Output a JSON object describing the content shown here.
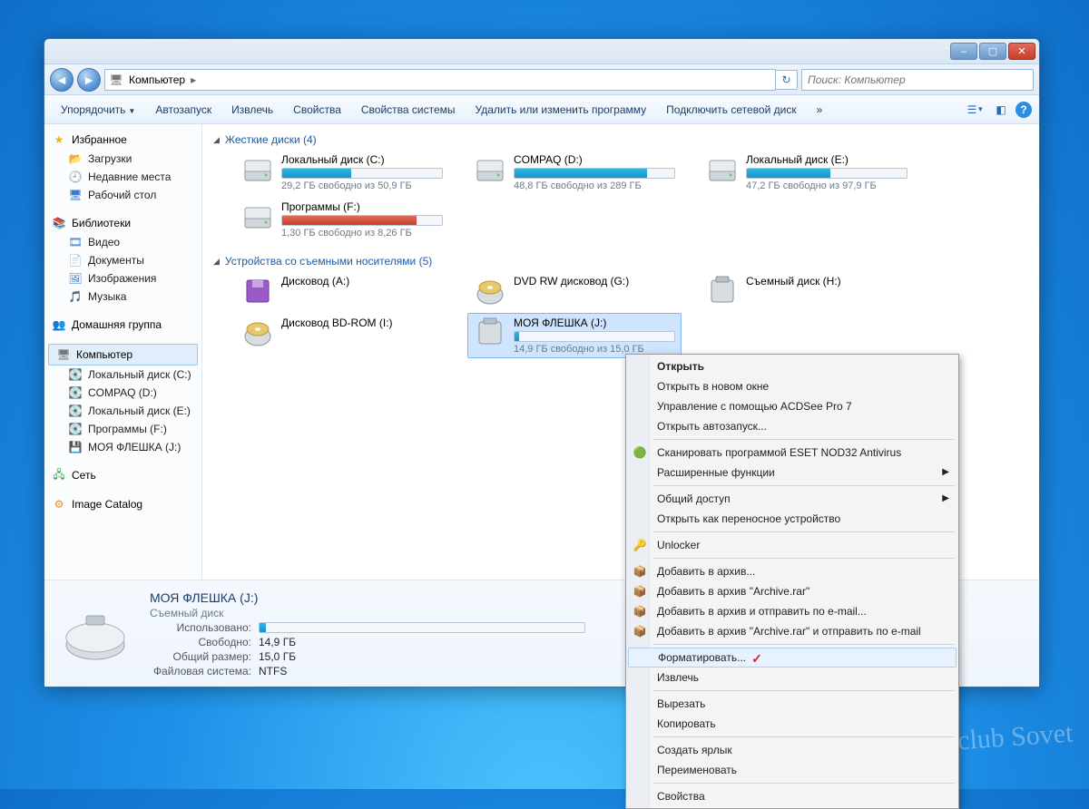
{
  "window_controls": {
    "min": "–",
    "max": "▢",
    "close": "✕"
  },
  "address": {
    "location": "Компьютер",
    "search_placeholder": "Поиск: Компьютер"
  },
  "toolbar": {
    "organize": "Упорядочить",
    "autorun": "Автозапуск",
    "eject": "Извлечь",
    "props": "Свойства",
    "sysprops": "Свойства системы",
    "uninstall": "Удалить или изменить программу",
    "mapdrive": "Подключить сетевой диск",
    "more": "»"
  },
  "sidebar": {
    "favorites": {
      "title": "Избранное",
      "items": [
        "Загрузки",
        "Недавние места",
        "Рабочий стол"
      ]
    },
    "libraries": {
      "title": "Библиотеки",
      "items": [
        "Видео",
        "Документы",
        "Изображения",
        "Музыка"
      ]
    },
    "homegroup": {
      "title": "Домашняя группа"
    },
    "computer": {
      "title": "Компьютер",
      "items": [
        "Локальный диск (C:)",
        "COMPAQ (D:)",
        "Локальный диск (E:)",
        "Программы  (F:)",
        "МОЯ ФЛЕШКА (J:)"
      ]
    },
    "network": {
      "title": "Сеть"
    },
    "catalog": {
      "title": "Image Catalog"
    }
  },
  "sections": {
    "hdd": {
      "title": "Жесткие диски (4)"
    },
    "removable": {
      "title": "Устройства со съемными носителями (5)"
    }
  },
  "drives": {
    "c": {
      "name": "Локальный диск (C:)",
      "sub": "29,2 ГБ свободно из 50,9 ГБ",
      "fill": 43
    },
    "d": {
      "name": "COMPAQ (D:)",
      "sub": "48,8 ГБ свободно из 289 ГБ",
      "fill": 83
    },
    "e": {
      "name": "Локальный диск (E:)",
      "sub": "47,2 ГБ свободно из 97,9 ГБ",
      "fill": 52
    },
    "f": {
      "name": "Программы  (F:)",
      "sub": "1,30 ГБ свободно из 8,26 ГБ",
      "fill": 84,
      "red": true
    },
    "a": {
      "name": "Дисковод (A:)"
    },
    "g": {
      "name": "DVD RW дисковод (G:)"
    },
    "h": {
      "name": "Съемный диск (H:)"
    },
    "i": {
      "name": "Дисковод BD-ROM (I:)"
    },
    "j": {
      "name": "МОЯ ФЛЕШКА (J:)",
      "sub": "14,9 ГБ свободно из 15,0 ГБ",
      "fill": 3
    }
  },
  "details": {
    "title": "МОЯ ФЛЕШКА (J:)",
    "type": "Съемный диск",
    "used_label": "Использовано:",
    "free_label": "Свободно:",
    "free_val": "14,9 ГБ",
    "total_label": "Общий размер:",
    "total_val": "15,0 ГБ",
    "fs_label": "Файловая система:",
    "fs_val": "NTFS",
    "fill": 2
  },
  "context_menu": [
    {
      "t": "Открыть",
      "bold": true
    },
    {
      "t": "Открыть в новом окне"
    },
    {
      "t": "Управление с помощью ACDSee Pro 7"
    },
    {
      "t": "Открыть автозапуск..."
    },
    {
      "sep": true
    },
    {
      "t": "Сканировать программой ESET NOD32 Antivirus",
      "ic": "🟢"
    },
    {
      "t": "Расширенные функции",
      "arrow": true
    },
    {
      "sep": true
    },
    {
      "t": "Общий доступ",
      "arrow": true
    },
    {
      "t": "Открыть как переносное устройство"
    },
    {
      "sep": true
    },
    {
      "t": "Unlocker",
      "ic": "🔑"
    },
    {
      "sep": true
    },
    {
      "t": "Добавить в архив...",
      "ic": "📦"
    },
    {
      "t": "Добавить в архив \"Archive.rar\"",
      "ic": "📦"
    },
    {
      "t": "Добавить в архив и отправить по e-mail...",
      "ic": "📦"
    },
    {
      "t": "Добавить в архив \"Archive.rar\" и отправить по e-mail",
      "ic": "📦"
    },
    {
      "sep": true
    },
    {
      "t": "Форматировать...",
      "hl": true,
      "check": true
    },
    {
      "t": "Извлечь"
    },
    {
      "sep": true
    },
    {
      "t": "Вырезать"
    },
    {
      "t": "Копировать"
    },
    {
      "sep": true
    },
    {
      "t": "Создать ярлык"
    },
    {
      "t": "Переименовать"
    },
    {
      "sep": true
    },
    {
      "t": "Свойства"
    }
  ],
  "watermark": "club Sovet"
}
